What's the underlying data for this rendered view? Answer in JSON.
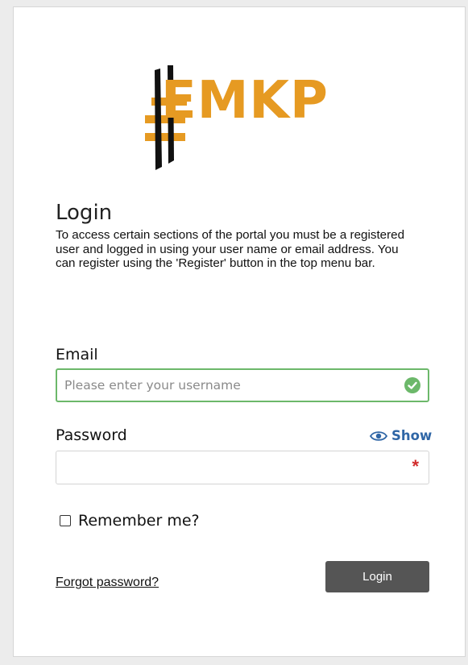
{
  "brand": {
    "logo_text": "EMKP",
    "accent_color": "#e69a22",
    "logo_icon": "hash-bars-icon"
  },
  "login": {
    "title": "Login",
    "intro": "To access certain sections of the portal you must be a registered user and logged in using your user name or email address. You can register using the 'Register' button in the top menu bar."
  },
  "form": {
    "email": {
      "label": "Email",
      "value": "",
      "placeholder": "Please enter your username",
      "valid_icon": "check-circle-icon",
      "valid_color": "#6cb86a"
    },
    "password": {
      "label": "Password",
      "value": "",
      "placeholder": "",
      "show_label": "Show",
      "show_icon": "eye-icon",
      "required_mark": "*",
      "required_color": "#d12c2c"
    },
    "remember": {
      "label": "Remember me?",
      "checked": false
    },
    "forgot_label": "Forgot password?",
    "submit_label": "Login",
    "button_color": "#555555",
    "link_color": "#2f66a6"
  }
}
